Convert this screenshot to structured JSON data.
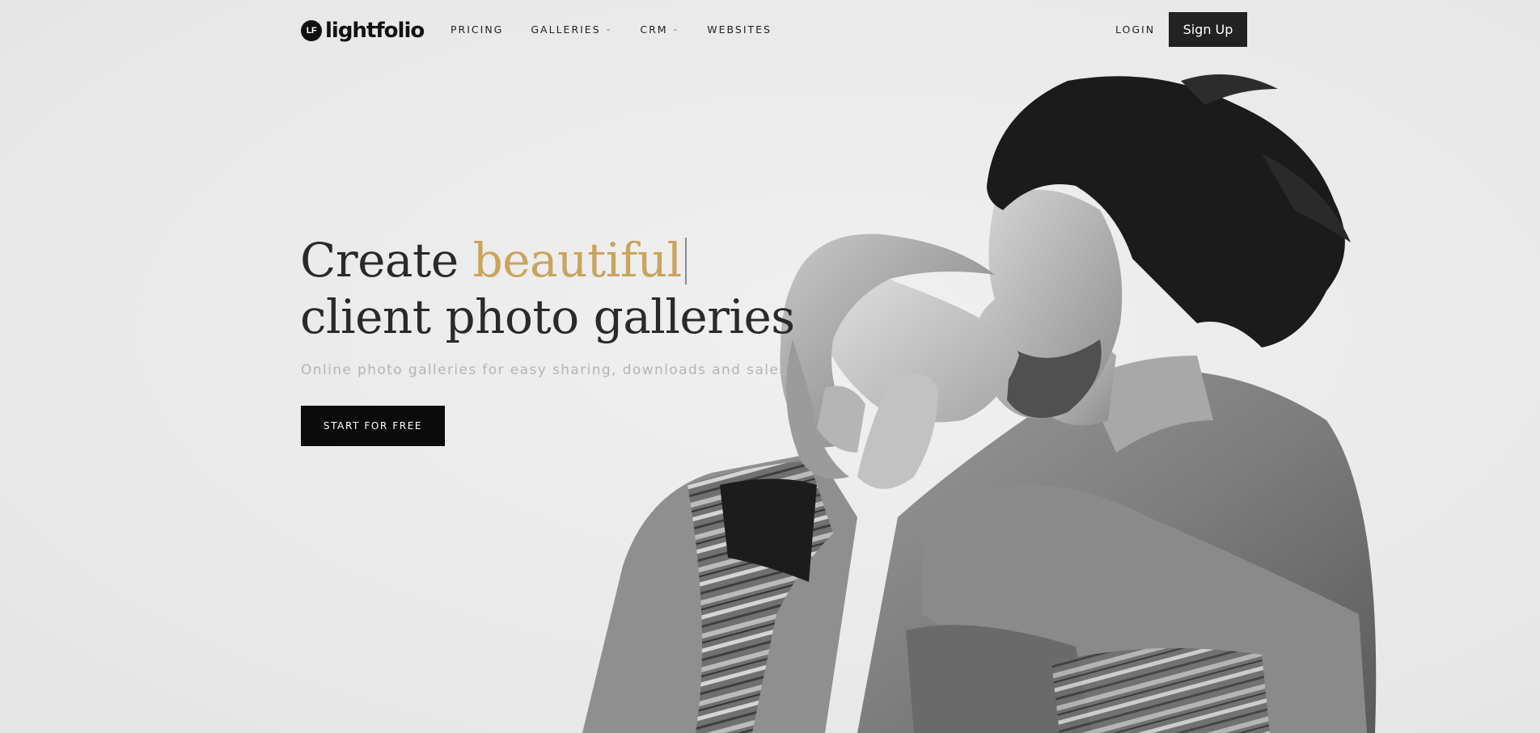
{
  "header": {
    "logo_mark": "LF",
    "logo_text": "lightfolio",
    "nav": [
      {
        "label": "PRICING",
        "has_dropdown": false
      },
      {
        "label": "GALLERIES",
        "has_dropdown": true
      },
      {
        "label": "CRM",
        "has_dropdown": true
      },
      {
        "label": "WEBSITES",
        "has_dropdown": false
      }
    ],
    "login_label": "LOGIN",
    "signup_label": "Sign Up"
  },
  "hero": {
    "headline_prefix": "Create",
    "headline_accent": "beautiful",
    "headline_line2": "client photo galleries",
    "subtitle": "Online photo galleries for easy sharing, downloads and sales",
    "cta_label": "START FOR FREE",
    "photo_icon": "couple-kissing-photo"
  },
  "colors": {
    "background": "#ececec",
    "accent_gold": "#c9a45c",
    "button_dark": "#0b0b0b",
    "signup_bg": "#222222"
  }
}
